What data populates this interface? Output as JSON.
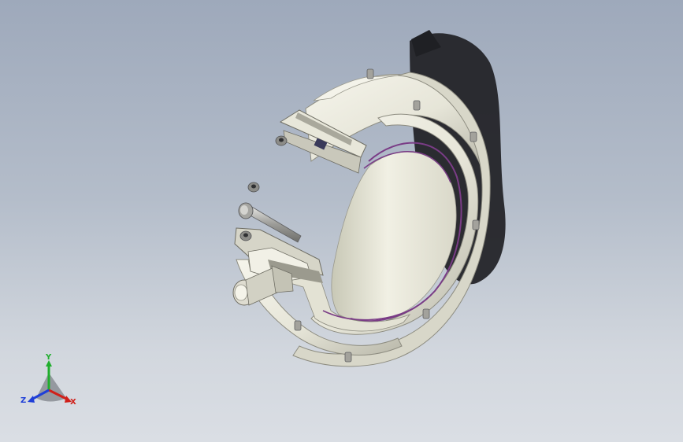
{
  "view_triad": {
    "x_label": "X",
    "y_label": "Y",
    "z_label": "Z",
    "x_color": "#d0201a",
    "y_color": "#1fae2c",
    "z_color": "#1f3fd8"
  },
  "model": {
    "body_color": "#ecebe0",
    "shadow_color": "#1f2024",
    "seal_color": "#7a3c86",
    "bolt_color": "#5f6062"
  }
}
